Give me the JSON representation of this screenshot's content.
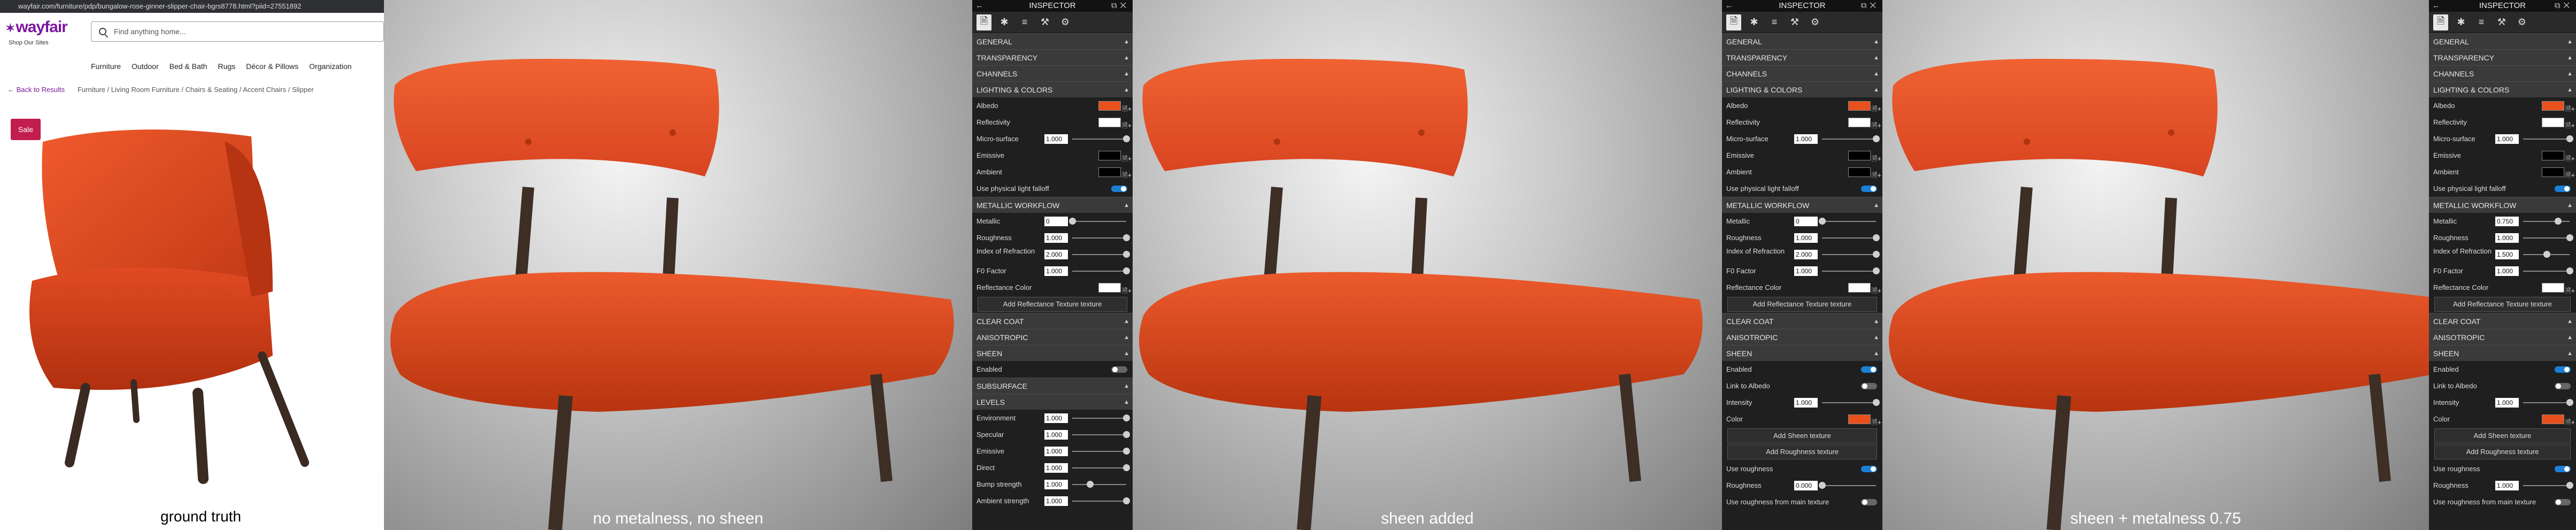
{
  "browser": {
    "url": "wayfair.com/furniture/pdp/bungalow-rose-ginner-slipper-chair-bgrs8778.html?piid=27551892"
  },
  "wayfair": {
    "logo": "wayfair",
    "tagline": "Shop Our Sites",
    "search_placeholder": "Find anything home...",
    "nav": [
      "Furniture",
      "Outdoor",
      "Bed & Bath",
      "Rugs",
      "Décor & Pillows",
      "Organization"
    ],
    "back_link": "Back to Results",
    "breadcrumb": "Furniture / Living Room Furniture / Chairs & Seating / Accent Chairs / Slipper",
    "badge": "Sale"
  },
  "labels": {
    "ground_truth": "ground truth",
    "scene1": "no metalness, no sheen",
    "scene2": "sheen added",
    "scene3": "sheen + metalness 0.75"
  },
  "colors": {
    "chair": "#e04a22",
    "albedo": "#e8501c",
    "toggle_on": "#1c7fd6"
  },
  "inspectors": [
    {
      "title": "INSPECTOR",
      "sections": [
        {
          "type": "sec",
          "label": "GENERAL"
        },
        {
          "type": "sec",
          "label": "TRANSPARENCY"
        },
        {
          "type": "sec",
          "label": "CHANNELS"
        },
        {
          "type": "sec",
          "label": "LIGHTING & COLORS"
        },
        {
          "type": "color",
          "label": "Albedo",
          "color": "#e8501c"
        },
        {
          "type": "color",
          "label": "Reflectivity",
          "color": "#ffffff"
        },
        {
          "type": "slider",
          "label": "Micro-surface",
          "value": "1.000",
          "pos": 1.0
        },
        {
          "type": "color",
          "label": "Emissive",
          "color": "#000000"
        },
        {
          "type": "color",
          "label": "Ambient",
          "color": "#000000"
        },
        {
          "type": "toggle",
          "label": "Use physical light falloff",
          "on": true
        },
        {
          "type": "sec",
          "label": "METALLIC WORKFLOW"
        },
        {
          "type": "slider",
          "label": "Metallic",
          "value": "0",
          "pos": 0.0
        },
        {
          "type": "slider",
          "label": "Roughness",
          "value": "1.000",
          "pos": 1.0
        },
        {
          "type": "slider2",
          "label": "Index of Refraction",
          "value": "2.000",
          "pos": 1.0
        },
        {
          "type": "slider",
          "label": "F0 Factor",
          "value": "1.000",
          "pos": 1.0
        },
        {
          "type": "color",
          "label": "Reflectance Color",
          "color": "#ffffff"
        },
        {
          "type": "button",
          "label": "Add Reflectance Texture texture"
        },
        {
          "type": "sec",
          "label": "CLEAR COAT"
        },
        {
          "type": "sec",
          "label": "ANISOTROPIC"
        },
        {
          "type": "sec",
          "label": "SHEEN"
        },
        {
          "type": "toggle",
          "label": "Enabled",
          "on": false
        },
        {
          "type": "sec",
          "label": "SUBSURFACE"
        },
        {
          "type": "sec",
          "label": "LEVELS"
        },
        {
          "type": "slider",
          "label": "Environment",
          "value": "1.000",
          "pos": 1.0
        },
        {
          "type": "slider",
          "label": "Specular",
          "value": "1.000",
          "pos": 1.0
        },
        {
          "type": "slider",
          "label": "Emissive",
          "value": "1.000",
          "pos": 1.0
        },
        {
          "type": "slider",
          "label": "Direct",
          "value": "1.000",
          "pos": 1.0
        },
        {
          "type": "slider",
          "label": "Bump strength",
          "value": "1.000",
          "pos": 0.33
        },
        {
          "type": "slider",
          "label": "Ambient strength",
          "value": "1.000",
          "pos": 1.0
        }
      ]
    },
    {
      "title": "INSPECTOR",
      "sections": [
        {
          "type": "sec",
          "label": "GENERAL"
        },
        {
          "type": "sec",
          "label": "TRANSPARENCY"
        },
        {
          "type": "sec",
          "label": "CHANNELS"
        },
        {
          "type": "sec",
          "label": "LIGHTING & COLORS"
        },
        {
          "type": "color",
          "label": "Albedo",
          "color": "#e8501c"
        },
        {
          "type": "color",
          "label": "Reflectivity",
          "color": "#ffffff"
        },
        {
          "type": "slider",
          "label": "Micro-surface",
          "value": "1.000",
          "pos": 1.0
        },
        {
          "type": "color",
          "label": "Emissive",
          "color": "#000000"
        },
        {
          "type": "color",
          "label": "Ambient",
          "color": "#000000"
        },
        {
          "type": "toggle",
          "label": "Use physical light falloff",
          "on": true
        },
        {
          "type": "sec",
          "label": "METALLIC WORKFLOW"
        },
        {
          "type": "slider",
          "label": "Metallic",
          "value": "0",
          "pos": 0.0
        },
        {
          "type": "slider",
          "label": "Roughness",
          "value": "1.000",
          "pos": 1.0
        },
        {
          "type": "slider2",
          "label": "Index of Refraction",
          "value": "2.000",
          "pos": 1.0
        },
        {
          "type": "slider",
          "label": "F0 Factor",
          "value": "1.000",
          "pos": 1.0
        },
        {
          "type": "color",
          "label": "Reflectance Color",
          "color": "#ffffff"
        },
        {
          "type": "button",
          "label": "Add Reflectance Texture texture"
        },
        {
          "type": "sec",
          "label": "CLEAR COAT"
        },
        {
          "type": "sec",
          "label": "ANISOTROPIC"
        },
        {
          "type": "sec",
          "label": "SHEEN"
        },
        {
          "type": "toggle",
          "label": "Enabled",
          "on": true
        },
        {
          "type": "toggle",
          "label": "Link to Albedo",
          "on": false
        },
        {
          "type": "slider",
          "label": "Intensity",
          "value": "1.000",
          "pos": 1.0
        },
        {
          "type": "color",
          "label": "Color",
          "color": "#e8501c"
        },
        {
          "type": "button",
          "label": "Add Sheen texture"
        },
        {
          "type": "button",
          "label": "Add Roughness texture"
        },
        {
          "type": "toggle",
          "label": "Use roughness",
          "on": true
        },
        {
          "type": "slider",
          "label": "Roughness",
          "value": "0.000",
          "pos": 0.0
        },
        {
          "type": "toggle",
          "label": "Use roughness from main texture",
          "on": false
        }
      ]
    },
    {
      "title": "INSPECTOR",
      "sections": [
        {
          "type": "sec",
          "label": "GENERAL"
        },
        {
          "type": "sec",
          "label": "TRANSPARENCY"
        },
        {
          "type": "sec",
          "label": "CHANNELS"
        },
        {
          "type": "sec",
          "label": "LIGHTING & COLORS"
        },
        {
          "type": "color",
          "label": "Albedo",
          "color": "#e8501c"
        },
        {
          "type": "color",
          "label": "Reflectivity",
          "color": "#ffffff"
        },
        {
          "type": "slider",
          "label": "Micro-surface",
          "value": "1.000",
          "pos": 1.0
        },
        {
          "type": "color",
          "label": "Emissive",
          "color": "#000000"
        },
        {
          "type": "color",
          "label": "Ambient",
          "color": "#000000"
        },
        {
          "type": "toggle",
          "label": "Use physical light falloff",
          "on": true
        },
        {
          "type": "sec",
          "label": "METALLIC WORKFLOW"
        },
        {
          "type": "slider",
          "label": "Metallic",
          "value": "0.750",
          "pos": 0.75
        },
        {
          "type": "slider",
          "label": "Roughness",
          "value": "1.000",
          "pos": 1.0
        },
        {
          "type": "slider2",
          "label": "Index of Refraction",
          "value": "1.500",
          "pos": 0.5
        },
        {
          "type": "slider",
          "label": "F0 Factor",
          "value": "1.000",
          "pos": 1.0
        },
        {
          "type": "color",
          "label": "Reflectance Color",
          "color": "#ffffff"
        },
        {
          "type": "button",
          "label": "Add Reflectance Texture texture"
        },
        {
          "type": "sec",
          "label": "CLEAR COAT"
        },
        {
          "type": "sec",
          "label": "ANISOTROPIC"
        },
        {
          "type": "sec",
          "label": "SHEEN"
        },
        {
          "type": "toggle",
          "label": "Enabled",
          "on": true
        },
        {
          "type": "toggle",
          "label": "Link to Albedo",
          "on": false
        },
        {
          "type": "slider",
          "label": "Intensity",
          "value": "1.000",
          "pos": 1.0
        },
        {
          "type": "color",
          "label": "Color",
          "color": "#e8501c"
        },
        {
          "type": "button",
          "label": "Add Sheen texture"
        },
        {
          "type": "button",
          "label": "Add Roughness texture"
        },
        {
          "type": "toggle",
          "label": "Use roughness",
          "on": true
        },
        {
          "type": "slider",
          "label": "Roughness",
          "value": "1.000",
          "pos": 1.0
        },
        {
          "type": "toggle",
          "label": "Use roughness from main texture",
          "on": false
        }
      ]
    }
  ]
}
